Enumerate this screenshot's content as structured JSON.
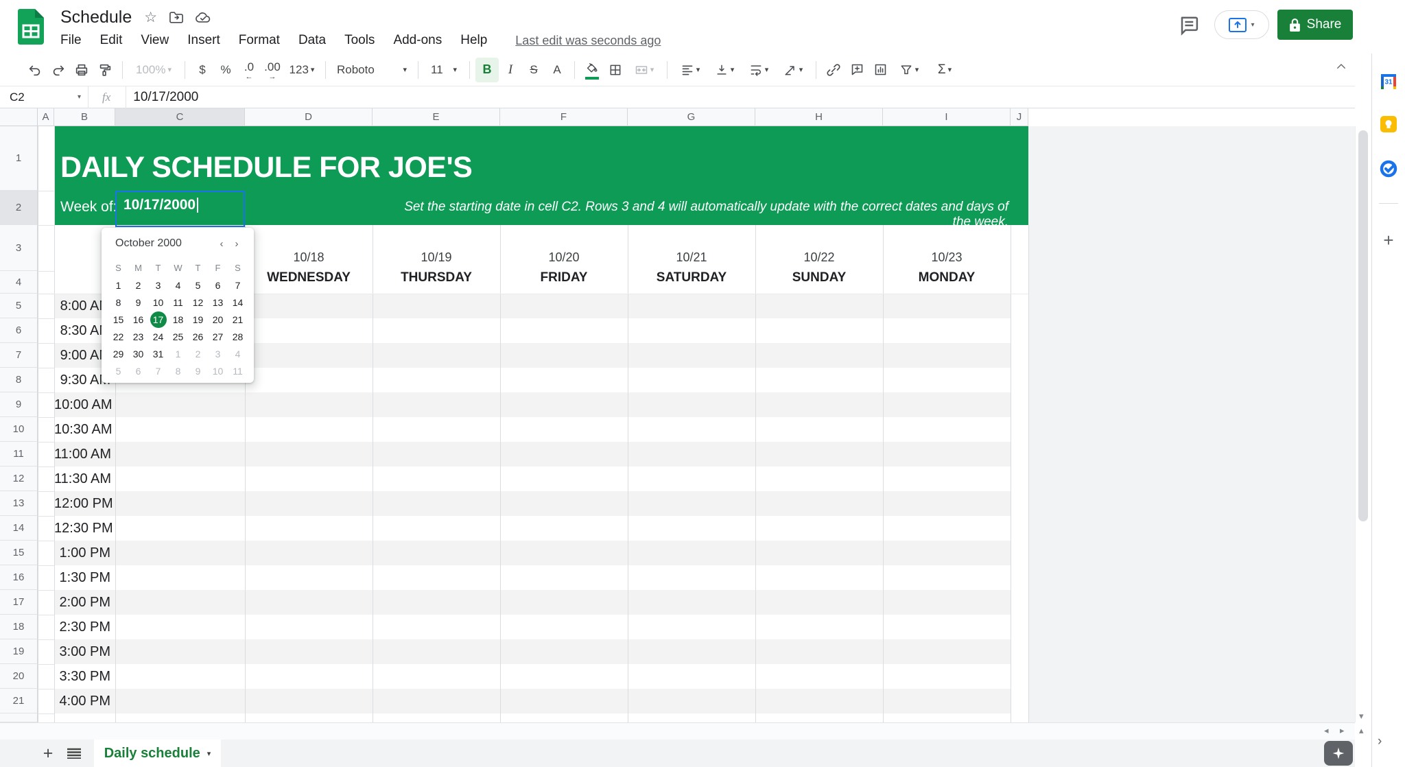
{
  "app": {
    "doc_title": "Schedule",
    "menu_items": [
      "File",
      "Edit",
      "View",
      "Insert",
      "Format",
      "Data",
      "Tools",
      "Add-ons",
      "Help"
    ],
    "last_edit": "Last edit was seconds ago",
    "share_label": "Share"
  },
  "toolbar": {
    "zoom_value": "100%",
    "currency_label": "$",
    "percent_label": "%",
    "decrease_decimal_label": ".0",
    "increase_decimal_label": ".00",
    "number_format_label": "123",
    "font_family_value": "Roboto",
    "font_size_value": "11",
    "bold_label": "B",
    "italic_label": "I",
    "strikethrough_label": "S",
    "text_color_label": "A",
    "functions_label": "Σ"
  },
  "formula_bar": {
    "cell_reference": "C2",
    "fx_label": "fx",
    "value": "10/17/2000"
  },
  "grid": {
    "column_letters": [
      "A",
      "B",
      "C",
      "D",
      "E",
      "F",
      "G",
      "H",
      "I",
      "J"
    ],
    "row_numbers": [
      "1",
      "2",
      "3",
      "4",
      "5",
      "6",
      "7",
      "8",
      "9",
      "10",
      "11",
      "12",
      "13",
      "14",
      "15",
      "16",
      "17",
      "18",
      "19",
      "20",
      "21"
    ],
    "selected_column": "C",
    "selected_row": "2"
  },
  "sheet_content": {
    "title": "DAILY SCHEDULE FOR JOE'S",
    "week_of_label": "Week of:",
    "week_of_value": "10/17/2000",
    "instruction": "Set the starting date in cell C2. Rows 3 and 4 will automatically update with the correct dates and days of the week.",
    "day_columns": [
      {
        "date": "10/18",
        "day": "WEDNESDAY"
      },
      {
        "date": "10/19",
        "day": "THURSDAY"
      },
      {
        "date": "10/20",
        "day": "FRIDAY"
      },
      {
        "date": "10/21",
        "day": "SATURDAY"
      },
      {
        "date": "10/22",
        "day": "SUNDAY"
      },
      {
        "date": "10/23",
        "day": "MONDAY"
      }
    ],
    "time_rows": [
      "8:00 AM",
      "8:30 AM",
      "9:00 AM",
      "9:30 AM",
      "10:00 AM",
      "10:30 AM",
      "11:00 AM",
      "11:30 AM",
      "12:00 PM",
      "12:30 PM",
      "1:00 PM",
      "1:30 PM",
      "2:00 PM",
      "2:30 PM",
      "3:00 PM",
      "3:30 PM",
      "4:00 PM"
    ]
  },
  "date_picker": {
    "month_label": "October 2000",
    "prev_label": "‹",
    "next_label": "›",
    "weekday_letters": [
      "S",
      "M",
      "T",
      "W",
      "T",
      "F",
      "S"
    ],
    "selected_day": "17",
    "weeks": [
      [
        {
          "t": "1",
          "m": 0
        },
        {
          "t": "2",
          "m": 0
        },
        {
          "t": "3",
          "m": 0
        },
        {
          "t": "4",
          "m": 0
        },
        {
          "t": "5",
          "m": 0
        },
        {
          "t": "6",
          "m": 0
        },
        {
          "t": "7",
          "m": 0
        }
      ],
      [
        {
          "t": "8",
          "m": 0
        },
        {
          "t": "9",
          "m": 0
        },
        {
          "t": "10",
          "m": 0
        },
        {
          "t": "11",
          "m": 0
        },
        {
          "t": "12",
          "m": 0
        },
        {
          "t": "13",
          "m": 0
        },
        {
          "t": "14",
          "m": 0
        }
      ],
      [
        {
          "t": "15",
          "m": 0
        },
        {
          "t": "16",
          "m": 0
        },
        {
          "t": "17",
          "m": 0,
          "s": 1
        },
        {
          "t": "18",
          "m": 0
        },
        {
          "t": "19",
          "m": 0
        },
        {
          "t": "20",
          "m": 0
        },
        {
          "t": "21",
          "m": 0
        }
      ],
      [
        {
          "t": "22",
          "m": 0
        },
        {
          "t": "23",
          "m": 0
        },
        {
          "t": "24",
          "m": 0
        },
        {
          "t": "25",
          "m": 0
        },
        {
          "t": "26",
          "m": 0
        },
        {
          "t": "27",
          "m": 0
        },
        {
          "t": "28",
          "m": 0
        }
      ],
      [
        {
          "t": "29",
          "m": 0
        },
        {
          "t": "30",
          "m": 0
        },
        {
          "t": "31",
          "m": 0
        },
        {
          "t": "1",
          "m": 1
        },
        {
          "t": "2",
          "m": 1
        },
        {
          "t": "3",
          "m": 1
        },
        {
          "t": "4",
          "m": 1
        }
      ],
      [
        {
          "t": "5",
          "m": 1
        },
        {
          "t": "6",
          "m": 1
        },
        {
          "t": "7",
          "m": 1
        },
        {
          "t": "8",
          "m": 1
        },
        {
          "t": "9",
          "m": 1
        },
        {
          "t": "10",
          "m": 1
        },
        {
          "t": "11",
          "m": 1
        }
      ]
    ]
  },
  "sheet_tabs": {
    "active_tab": "Daily schedule"
  },
  "colors": {
    "header_green": "#0d9b55",
    "selection_blue": "#1a73e8",
    "share_button_green": "#188038",
    "tab_label_green": "#188038",
    "selected_day_green": "#0f8b47",
    "row_band_gray": "#f3f3f3"
  }
}
